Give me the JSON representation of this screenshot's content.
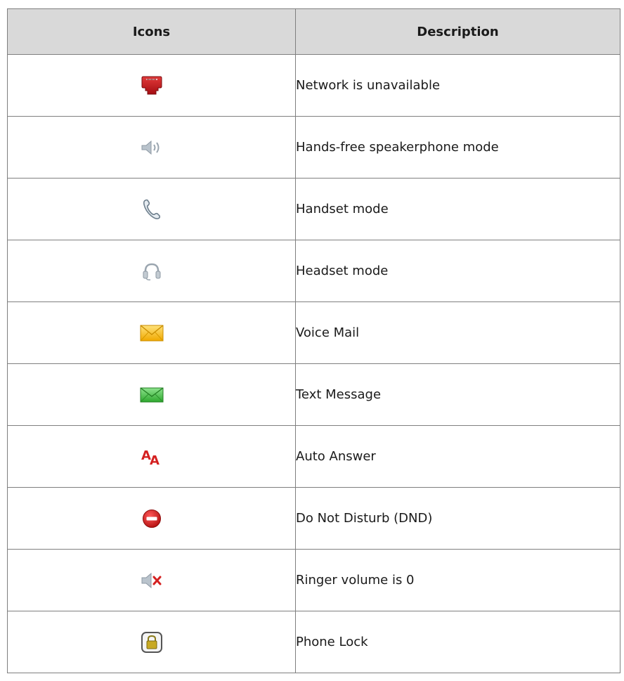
{
  "table": {
    "headers": {
      "icons": "Icons",
      "description": "Description"
    },
    "rows": [
      {
        "icon": "network-unavailable-icon",
        "description": "Network is unavailable"
      },
      {
        "icon": "speakerphone-icon",
        "description": "Hands-free speakerphone mode"
      },
      {
        "icon": "handset-icon",
        "description": "Handset mode"
      },
      {
        "icon": "headset-icon",
        "description": "Headset mode"
      },
      {
        "icon": "voice-mail-icon",
        "description": "Voice Mail"
      },
      {
        "icon": "text-message-icon",
        "description": "Text Message"
      },
      {
        "icon": "auto-answer-icon",
        "description": "Auto Answer"
      },
      {
        "icon": "do-not-disturb-icon",
        "description": "Do Not Disturb (DND)"
      },
      {
        "icon": "ringer-muted-icon",
        "description": "Ringer volume is 0"
      },
      {
        "icon": "phone-lock-icon",
        "description": "Phone Lock"
      }
    ]
  },
  "colors": {
    "header_background": "#d9d9d9",
    "border": "#7f7f7f",
    "network_red": "#c8161d",
    "voice_mail_yellow": "#f5b400",
    "text_message_green": "#3dbb3d",
    "dnd_red": "#d11a1a",
    "lock_gold": "#a08a1e"
  }
}
